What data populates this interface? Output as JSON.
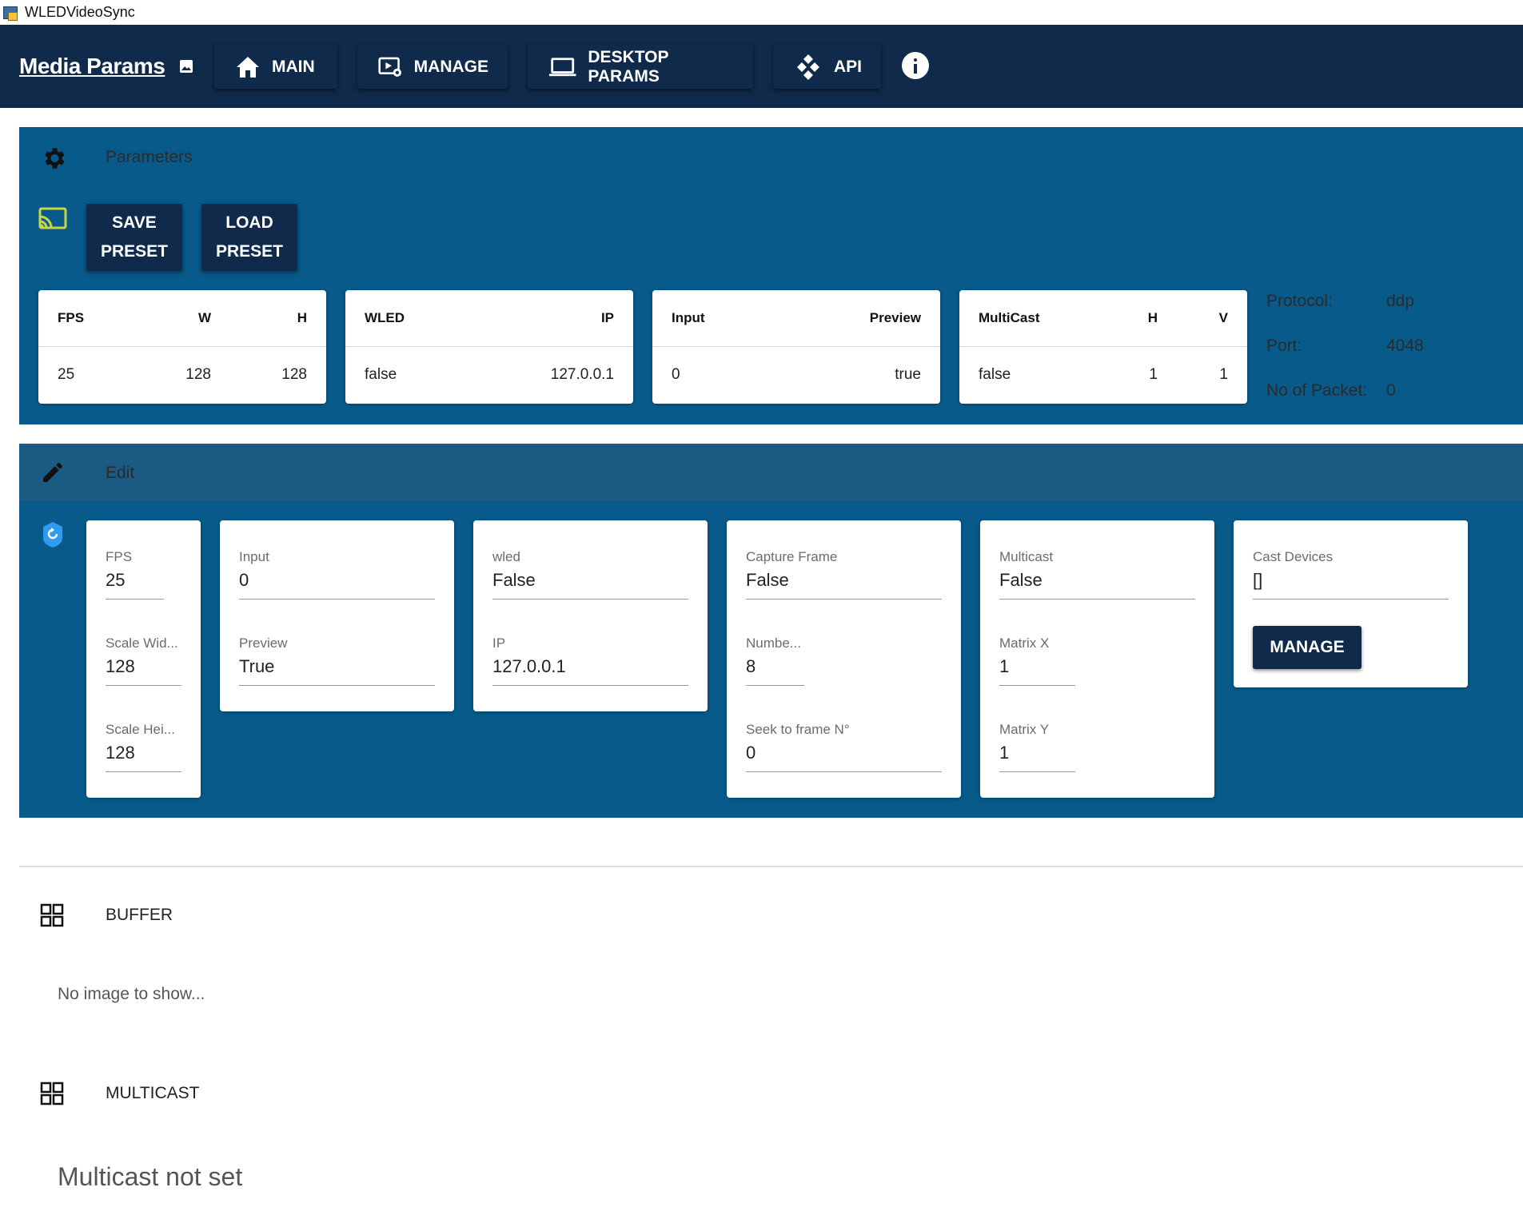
{
  "window": {
    "title": "WLEDVideoSync"
  },
  "header": {
    "brand": "Media Params",
    "nav": [
      {
        "label": "MAIN",
        "icon": "home-icon"
      },
      {
        "label": "MANAGE",
        "icon": "video-settings-icon"
      },
      {
        "label": "DESKTOP PARAMS",
        "icon": "laptop-icon"
      },
      {
        "label": "API",
        "icon": "api-icon"
      }
    ],
    "info_icon": "info-icon"
  },
  "parameters": {
    "title": "Parameters",
    "save_preset": "SAVE PRESET",
    "load_preset": "LOAD PRESET",
    "tables": [
      {
        "headers": [
          "FPS",
          "W",
          "H"
        ],
        "values": [
          "25",
          "128",
          "128"
        ]
      },
      {
        "headers": [
          "WLED",
          "IP"
        ],
        "values": [
          "false",
          "127.0.0.1"
        ]
      },
      {
        "headers": [
          "Input",
          "Preview"
        ],
        "values": [
          "0",
          "true"
        ]
      },
      {
        "headers": [
          "MultiCast",
          "H",
          "V"
        ],
        "values": [
          "false",
          "1",
          "1"
        ]
      }
    ],
    "protocol": {
      "protocol_label": "Protocol:",
      "protocol_value": "ddp",
      "port_label": "Port:",
      "port_value": "4048",
      "packets_label": "No of Packet:",
      "packets_value": "0"
    }
  },
  "edit": {
    "title": "Edit",
    "fps": {
      "label": "FPS",
      "value": "25"
    },
    "scale_width": {
      "label": "Scale Wid...",
      "value": "128"
    },
    "scale_height": {
      "label": "Scale Hei...",
      "value": "128"
    },
    "input": {
      "label": "Input",
      "value": "0"
    },
    "preview": {
      "label": "Preview",
      "value": "True"
    },
    "wled": {
      "label": "wled",
      "value": "False"
    },
    "ip": {
      "label": "IP",
      "value": "127.0.0.1"
    },
    "capture_frame": {
      "label": "Capture Frame",
      "value": "False"
    },
    "number": {
      "label": "Numbe...",
      "value": "8"
    },
    "seek": {
      "label": "Seek to frame N°",
      "value": "0"
    },
    "multicast": {
      "label": "Multicast",
      "value": "False"
    },
    "matrix_x": {
      "label": "Matrix X",
      "value": "1"
    },
    "matrix_y": {
      "label": "Matrix Y",
      "value": "1"
    },
    "cast_devices": {
      "label": "Cast Devices",
      "value": "[]"
    },
    "manage_label": "MANAGE"
  },
  "buffer": {
    "title": "BUFFER",
    "empty_text": "No image to show..."
  },
  "multicast_section": {
    "title": "MULTICAST",
    "empty_text": "Multicast not set"
  },
  "colors": {
    "nav_bg": "#0f2a4a",
    "panel_bg": "#075a8a",
    "edit_header_bg": "#1b5a82",
    "cast_icon": "#c8d44a",
    "reset_icon": "#2f9bf0"
  }
}
